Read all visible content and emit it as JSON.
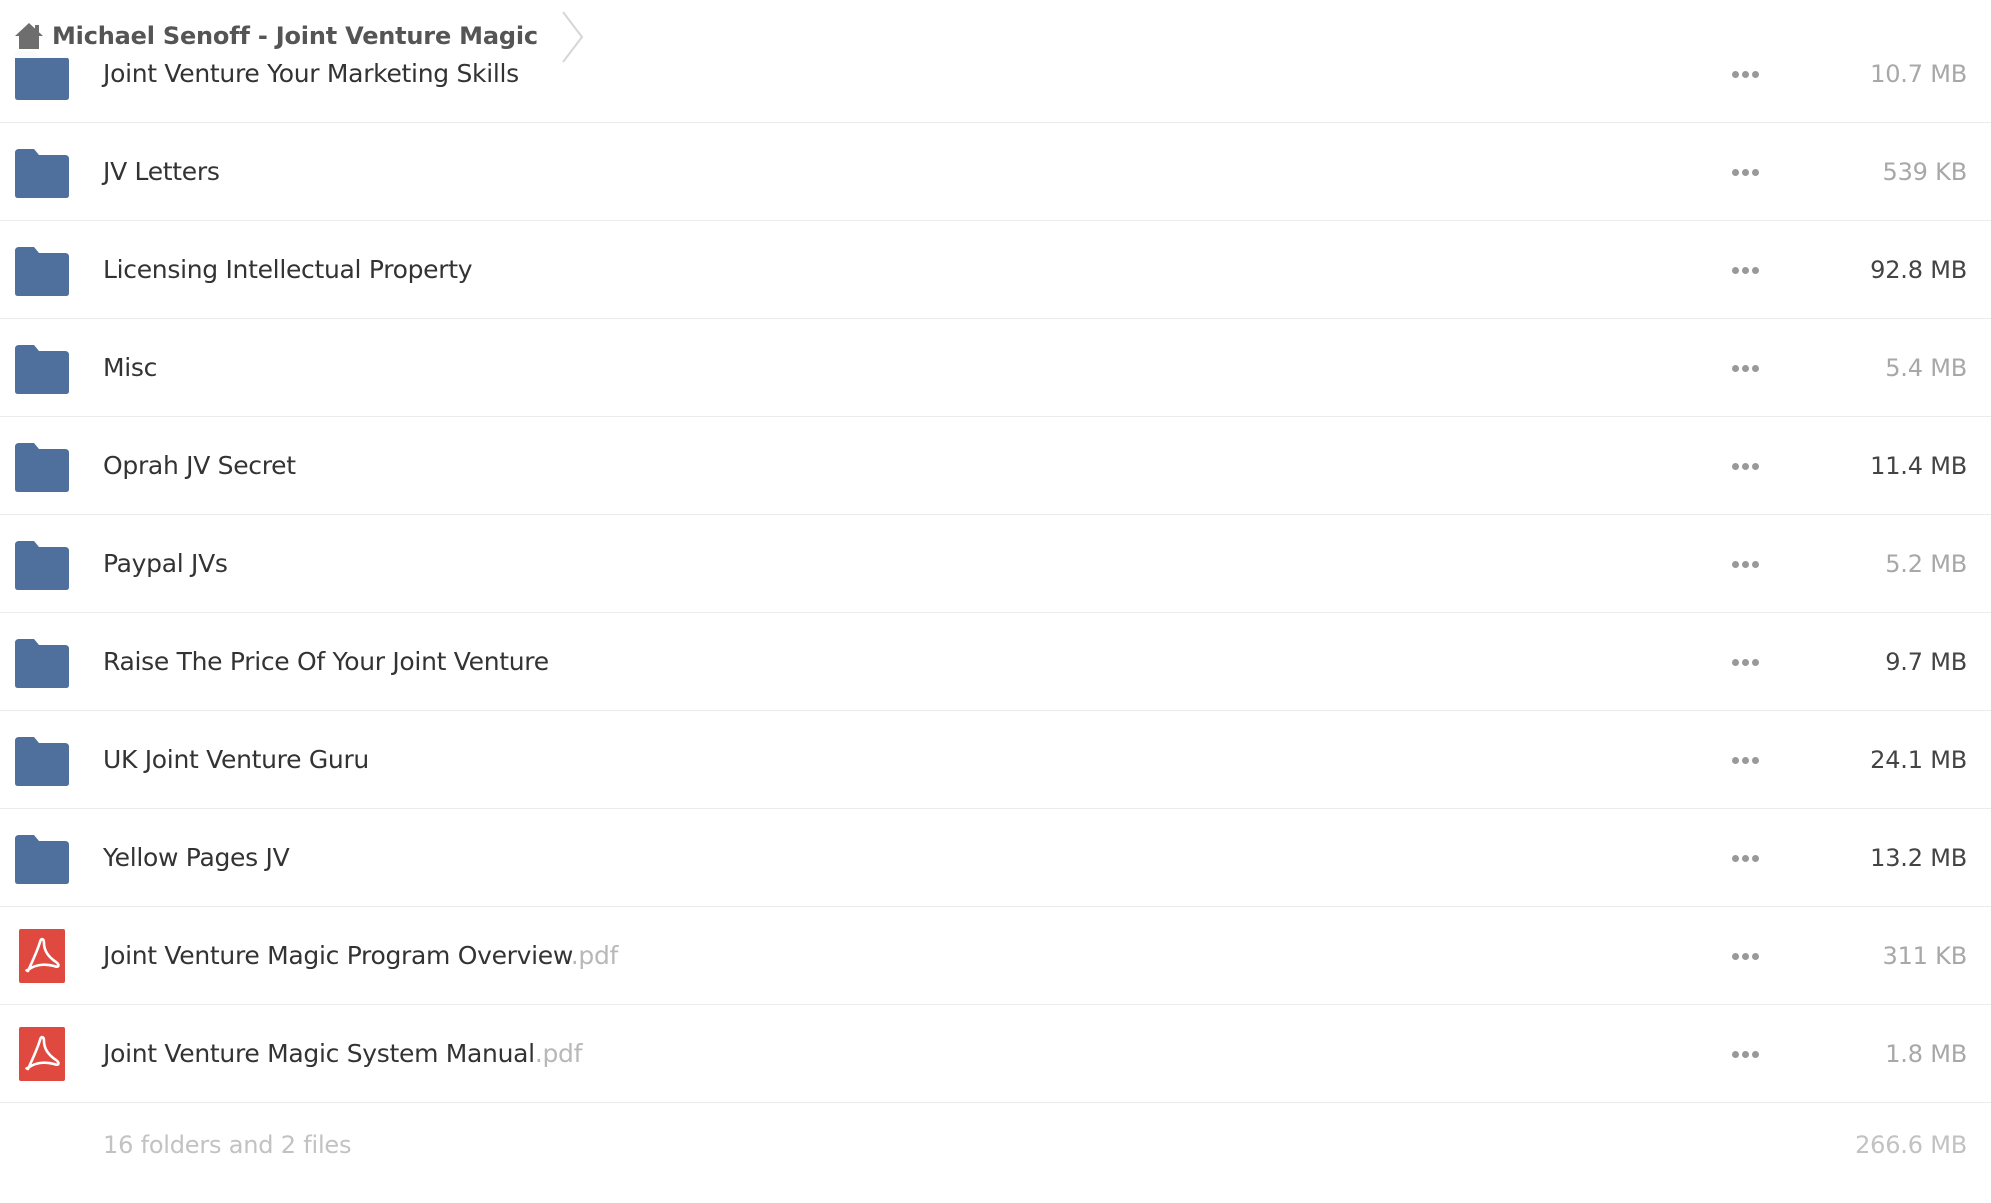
{
  "breadcrumb": {
    "icon": "home-icon",
    "label": "Michael Senoff - Joint Venture Magic"
  },
  "colors": {
    "folder": "#4f6f9c",
    "pdf": "#e0493f",
    "size_dark": "#444444",
    "size_light": "#a8a8a8"
  },
  "files": [
    {
      "type": "folder",
      "icon": "folder-icon",
      "name": "Joint Venture Your Marketing Skills",
      "ext": "",
      "size": "10.7 MB",
      "size_tone": "light"
    },
    {
      "type": "folder",
      "icon": "folder-icon",
      "name": "JV Letters",
      "ext": "",
      "size": "539 KB",
      "size_tone": "light"
    },
    {
      "type": "folder",
      "icon": "folder-icon",
      "name": "Licensing Intellectual Property",
      "ext": "",
      "size": "92.8 MB",
      "size_tone": "dark"
    },
    {
      "type": "folder",
      "icon": "folder-icon",
      "name": "Misc",
      "ext": "",
      "size": "5.4 MB",
      "size_tone": "light"
    },
    {
      "type": "folder",
      "icon": "folder-icon",
      "name": "Oprah JV Secret",
      "ext": "",
      "size": "11.4 MB",
      "size_tone": "dark"
    },
    {
      "type": "folder",
      "icon": "folder-icon",
      "name": "Paypal JVs",
      "ext": "",
      "size": "5.2 MB",
      "size_tone": "light"
    },
    {
      "type": "folder",
      "icon": "folder-icon",
      "name": "Raise The Price Of Your Joint Venture",
      "ext": "",
      "size": "9.7 MB",
      "size_tone": "dark"
    },
    {
      "type": "folder",
      "icon": "folder-icon",
      "name": "UK Joint Venture Guru",
      "ext": "",
      "size": "24.1 MB",
      "size_tone": "dark"
    },
    {
      "type": "folder",
      "icon": "folder-icon",
      "name": "Yellow Pages JV",
      "ext": "",
      "size": "13.2 MB",
      "size_tone": "dark"
    },
    {
      "type": "pdf",
      "icon": "pdf-icon",
      "name": "Joint Venture Magic Program Overview",
      "ext": ".pdf",
      "size": "311 KB",
      "size_tone": "light"
    },
    {
      "type": "pdf",
      "icon": "pdf-icon",
      "name": "Joint Venture Magic System Manual",
      "ext": ".pdf",
      "size": "1.8 MB",
      "size_tone": "light"
    }
  ],
  "summary": {
    "count": "16 folders and 2 files",
    "total": "266.6 MB"
  }
}
